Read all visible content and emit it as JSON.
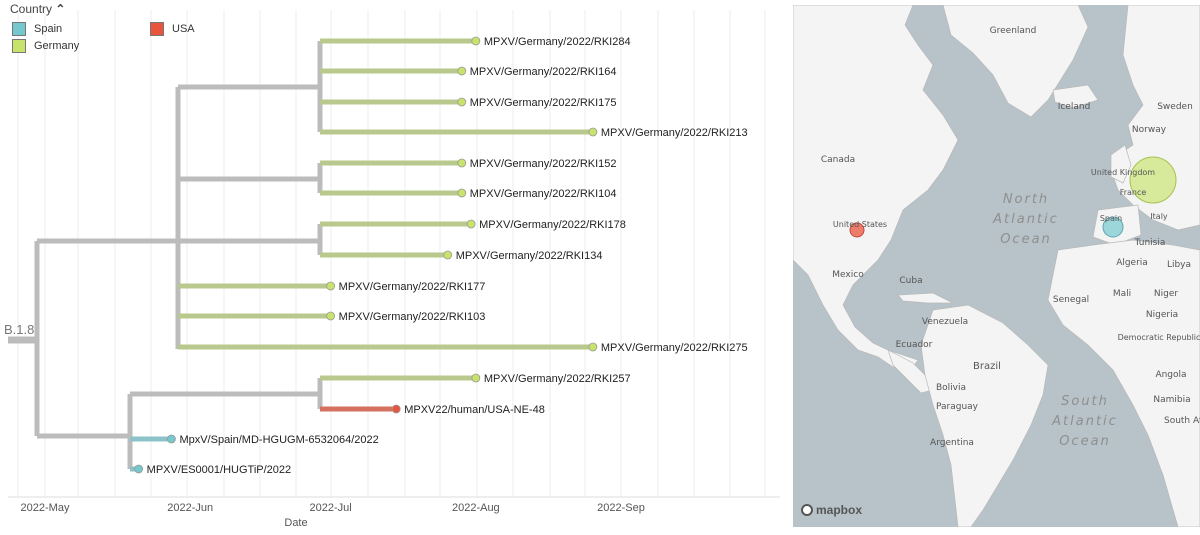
{
  "legend": {
    "title": "Country",
    "items": [
      {
        "label": "Spain",
        "color": "#76c8cf"
      },
      {
        "label": "Germany",
        "color": "#c7e36b"
      },
      {
        "label": "USA",
        "color": "#e8553c"
      }
    ]
  },
  "tree": {
    "root_label": "B.1.8",
    "x_axis_title": "Date",
    "date_ticks": [
      "2022-May",
      "2022-Jun",
      "2022-Jul",
      "2022-Aug",
      "2022-Sep"
    ],
    "branch_color": "#bcbcbc",
    "tips": [
      {
        "label": "MPXV/Germany/2022/RKI284",
        "country": "Germany",
        "date": "2022-08-01"
      },
      {
        "label": "MPXV/Germany/2022/RKI164",
        "country": "Germany",
        "date": "2022-07-29"
      },
      {
        "label": "MPXV/Germany/2022/RKI175",
        "country": "Germany",
        "date": "2022-07-29"
      },
      {
        "label": "MPXV/Germany/2022/RKI213",
        "country": "Germany",
        "date": "2022-08-26"
      },
      {
        "label": "MPXV/Germany/2022/RKI152",
        "country": "Germany",
        "date": "2022-07-29"
      },
      {
        "label": "MPXV/Germany/2022/RKI104",
        "country": "Germany",
        "date": "2022-07-29"
      },
      {
        "label": "MPXV/Germany/2022/RKI178",
        "country": "Germany",
        "date": "2022-07-31"
      },
      {
        "label": "MPXV/Germany/2022/RKI134",
        "country": "Germany",
        "date": "2022-07-26"
      },
      {
        "label": "MPXV/Germany/2022/RKI177",
        "country": "Germany",
        "date": "2022-07-01"
      },
      {
        "label": "MPXV/Germany/2022/RKI103",
        "country": "Germany",
        "date": "2022-07-01"
      },
      {
        "label": "MPXV/Germany/2022/RKI275",
        "country": "Germany",
        "date": "2022-08-26"
      },
      {
        "label": "MPXV/Germany/2022/RKI257",
        "country": "Germany",
        "date": "2022-08-01"
      },
      {
        "label": "MPXV22/human/USA-NE-48",
        "country": "USA",
        "date": "2022-07-15"
      },
      {
        "label": "MpxV/Spain/MD-HGUGM-6532064/2022",
        "country": "Spain",
        "date": "2022-05-28"
      },
      {
        "label": "MPXV/ES0001/HUGTiP/2022",
        "country": "Spain",
        "date": "2022-05-21"
      }
    ]
  },
  "map": {
    "provider": "mapbox",
    "labels": {
      "greenland": "Greenland",
      "iceland": "Iceland",
      "sweden": "Sweden",
      "norway": "Norway",
      "canada": "Canada",
      "united_kingdom": "United Kingdom",
      "france": "France",
      "spain": "Spain",
      "italy": "Italy",
      "united_states": "United States",
      "north_atlantic": "North Atlantic Ocean",
      "tunisia": "Tunisia",
      "mexico": "Mexico",
      "cuba": "Cuba",
      "algeria": "Algeria",
      "libya": "Libya",
      "senegal": "Senegal",
      "mali": "Mali",
      "niger": "Niger",
      "nigeria": "Nigeria",
      "venezuela": "Venezuela",
      "ecuador": "Ecuador",
      "brazil": "Brazil",
      "bolivia": "Bolivia",
      "paraguay": "Paraguay",
      "argentina": "Argentina",
      "south_atlantic": "South Atlantic Ocean",
      "angola": "Angola",
      "namibia": "Namibia",
      "democratic_republic": "Democratic Republic of the Congo",
      "south_africa": "South Af"
    },
    "markers": [
      {
        "country": "USA",
        "color": "#e8553c"
      },
      {
        "country": "Spain",
        "color": "#76c8cf"
      },
      {
        "country": "Germany",
        "color": "#c7e36b"
      }
    ]
  }
}
